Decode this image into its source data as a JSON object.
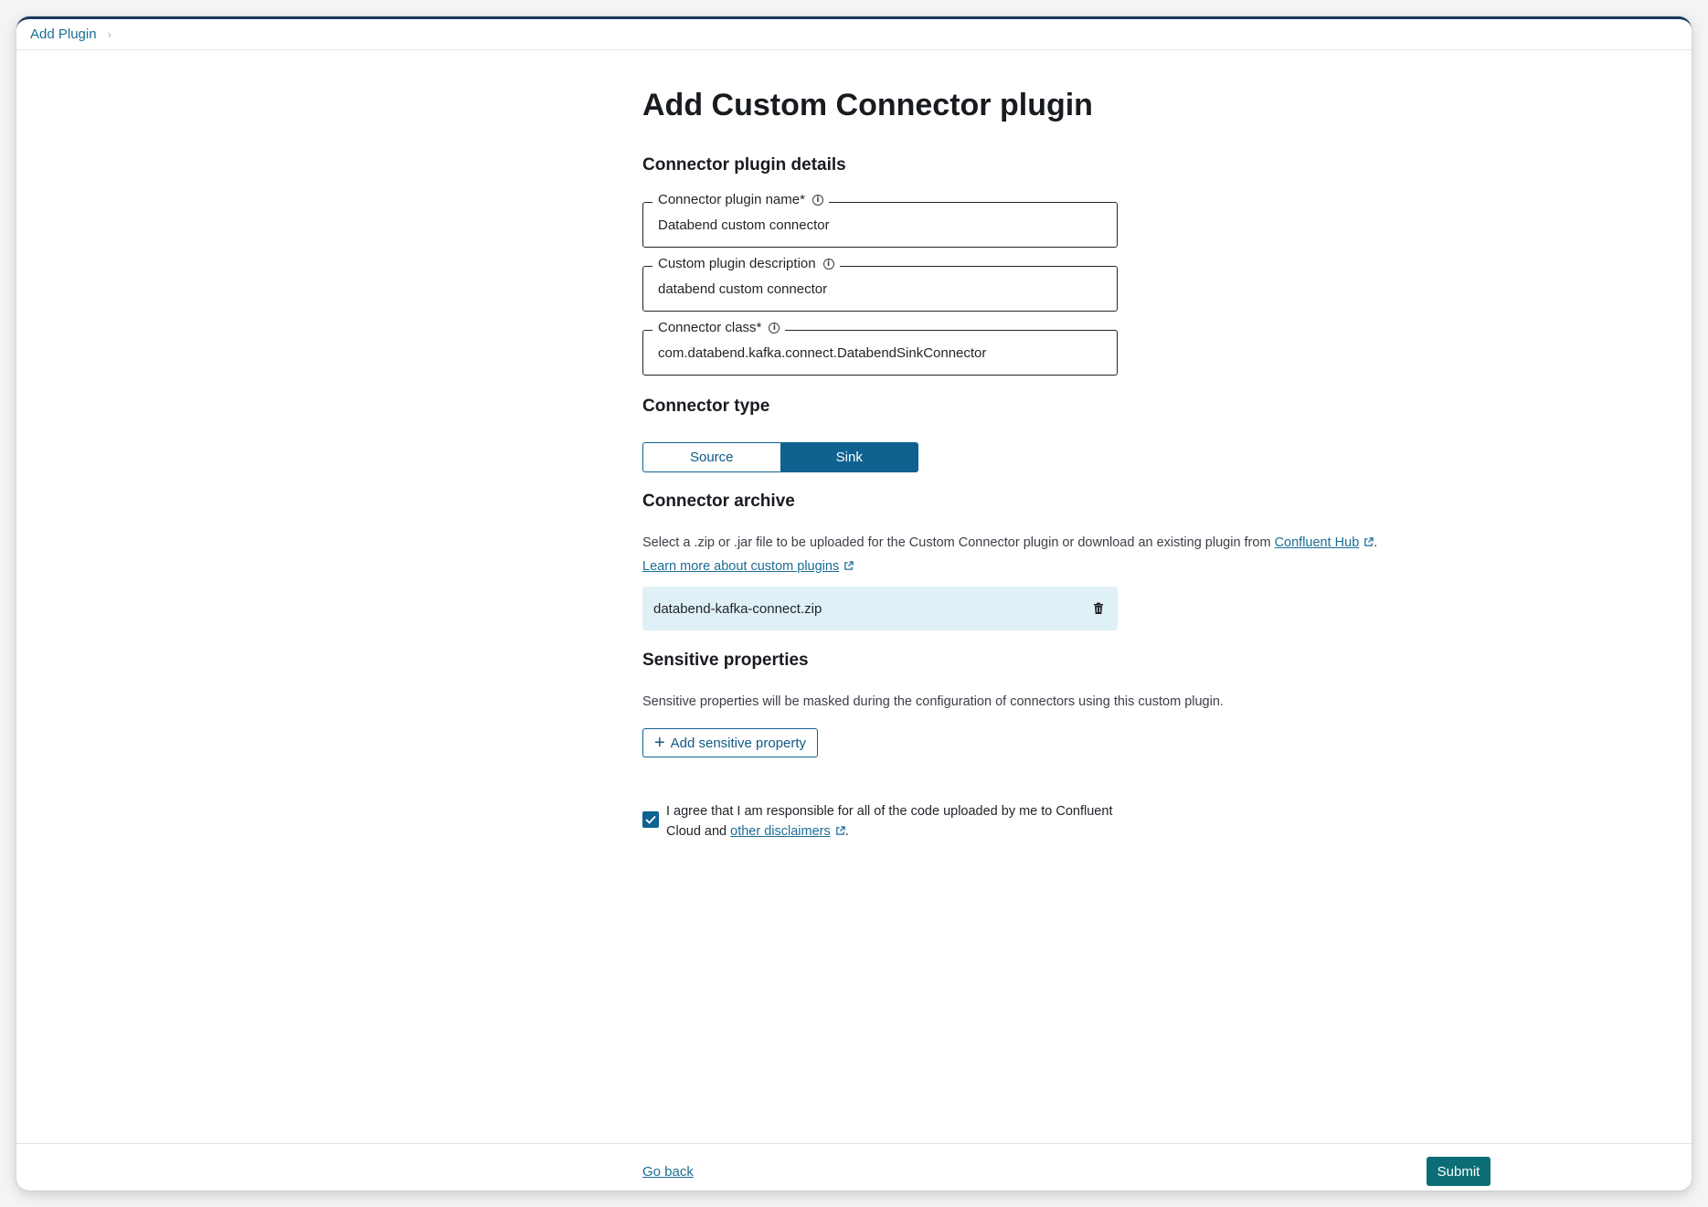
{
  "breadcrumb": {
    "items": [
      "Add Plugin"
    ]
  },
  "page": {
    "title": "Add Custom Connector plugin"
  },
  "details": {
    "heading": "Connector plugin details",
    "fields": [
      {
        "label": "Connector plugin name*",
        "value": "Databend custom connector"
      },
      {
        "label": "Custom plugin description",
        "value": "databend custom connector"
      },
      {
        "label": "Connector class*",
        "value": "com.databend.kafka.connect.DatabendSinkConnector"
      }
    ]
  },
  "connector_type": {
    "heading": "Connector type",
    "options": [
      "Source",
      "Sink"
    ],
    "selected": "Sink"
  },
  "archive": {
    "heading": "Connector archive",
    "help_prefix": "Select a .zip or .jar file to be uploaded for the Custom Connector plugin or download an existing plugin from ",
    "help_link": "Confluent Hub",
    "help_suffix": ".",
    "learn_link": "Learn more about custom plugins",
    "file_name": "databend-kafka-connect.zip"
  },
  "sensitive": {
    "heading": "Sensitive properties",
    "help": "Sensitive properties will be masked during the configuration of connectors using this custom plugin.",
    "add_label": "Add sensitive property"
  },
  "agreement": {
    "checked": true,
    "text_prefix": "I agree that I am responsible for all of the code uploaded by me to Confluent Cloud and ",
    "link": "other disclaimers",
    "text_suffix": "."
  },
  "footer": {
    "back_label": "Go back",
    "submit_label": "Submit"
  },
  "colors": {
    "primary": "#0f6190",
    "submit": "#0b6e76",
    "link": "#1c6c95",
    "file_bg": "#e0f0f7"
  }
}
